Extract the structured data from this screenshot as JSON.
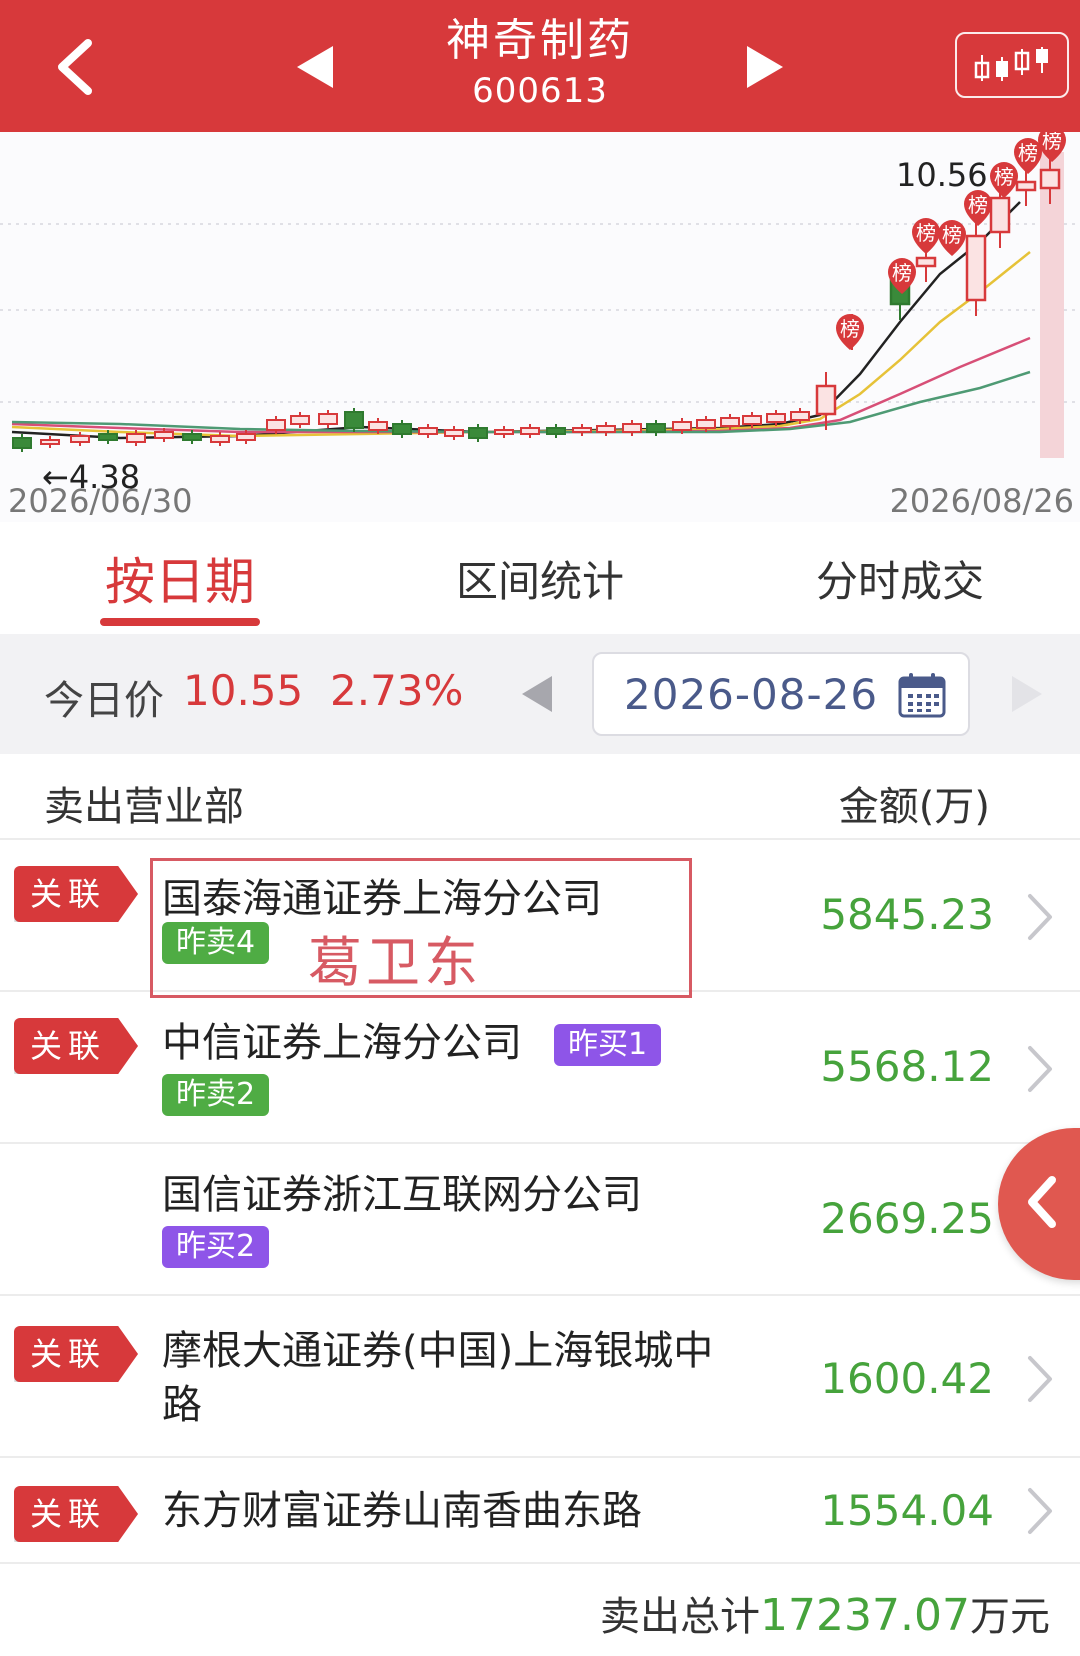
{
  "header": {
    "title": "神奇制药",
    "code": "600613"
  },
  "chart": {
    "start_date": "2026/06/30",
    "end_date": "2026/08/26",
    "low_label": "4.38",
    "high_label": "10.56",
    "marker_label": "榜"
  },
  "tabs": [
    {
      "label": "按日期",
      "active": true
    },
    {
      "label": "区间统计",
      "active": false
    },
    {
      "label": "分时成交",
      "active": false
    }
  ],
  "price_bar": {
    "label": "今日价",
    "price": "10.55",
    "change": "2.73%",
    "date": "2026-08-26"
  },
  "list_header": {
    "left": "卖出营业部",
    "right": "金额(万)"
  },
  "rows": [
    {
      "related": "关联",
      "name": "国泰海通证券上海分公司",
      "badges": [
        "昨卖4"
      ],
      "amount": "5845.23"
    },
    {
      "related": "关联",
      "name": "中信证券上海分公司",
      "badges": [
        "昨买1",
        "昨卖2"
      ],
      "amount": "5568.12"
    },
    {
      "related": "",
      "name": "国信证券浙江互联网分公司",
      "badges": [
        "昨买2"
      ],
      "amount": "2669.25"
    },
    {
      "related": "关联",
      "name_line1": "摩根大通证券(中国)上海银城中",
      "name_line2": "路",
      "badges": [],
      "amount": "1600.42"
    },
    {
      "related": "关联",
      "name": "东方财富证券山南香曲东路",
      "badges": [],
      "amount": "1554.04"
    }
  ],
  "annotation": {
    "name": "葛卫东"
  },
  "footer": {
    "label": "卖出总计",
    "total": "17237.07",
    "unit": "万元"
  },
  "colors": {
    "brand_red": "#d7393b",
    "amount_green": "#46a33c",
    "badge_green": "#4fac44",
    "badge_purple": "#8e55e8"
  }
}
